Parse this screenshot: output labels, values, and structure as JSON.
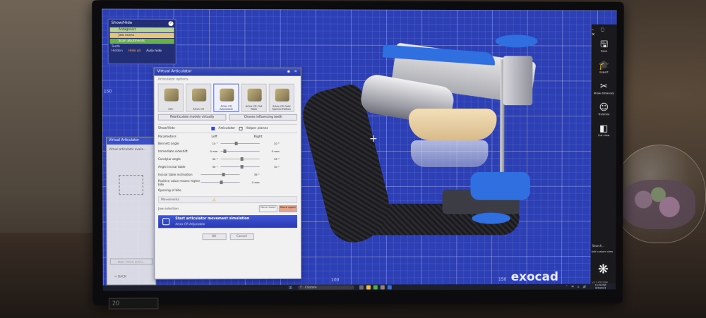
{
  "app": {
    "brand": "exocad"
  },
  "viewport": {
    "rulers": [
      "150",
      "100",
      "150",
      "50",
      "100",
      "150"
    ]
  },
  "showhide_panel": {
    "title": "Show/Hide",
    "items": [
      "Antagonist",
      "Jaw scans",
      "Scan abutments"
    ],
    "item_colors": [
      "#b8d39a",
      "#e5c47e",
      "#6ab04a"
    ],
    "teeth_label": "Teeth",
    "hidden_label": "Hidden",
    "hide_all": "Hide all",
    "auto_hide": "Auto hide"
  },
  "va_panel": {
    "title": "Virtual Articulator",
    "options_label": "Articulator options",
    "articulators": [
      {
        "name": "A2C"
      },
      {
        "name": "Artex CR"
      },
      {
        "name": "Artex CR Adjustable"
      },
      {
        "name": "Artex CR Flat Table"
      },
      {
        "name": "Artex CR Gold Special Edition"
      }
    ],
    "realculate_btn": "Rearticulate models virtually",
    "influence_btn": "Choose influencing teeth",
    "showhide_label": "Show/Hide",
    "articulator_cb": "Articulator",
    "helper_cb": "Helper planes",
    "parameters_label": "Parameters",
    "left_label": "Left",
    "right_label": "Right",
    "params": [
      {
        "name": "Bennett angle",
        "left": "10 °",
        "right": "10 °"
      },
      {
        "name": "Immediate sideshift",
        "left": "0 mm",
        "right": "0 mm"
      },
      {
        "name": "Condylar angle",
        "left": "30 °",
        "right": "35 °"
      },
      {
        "name": "Angle incisal table",
        "left": "30 °",
        "right": "30 °"
      }
    ],
    "incisal_inclination": {
      "name": "Incisal table inclination",
      "value": "35 °"
    },
    "positive_values": {
      "name": "Positive value means higher bite",
      "value": "0 mm"
    },
    "opening_bite": {
      "name": "Opening of bite"
    },
    "movements_label": "Movements",
    "jaw_selection_label": "Jaw selection",
    "move_lower": "Move lower",
    "move_upper": "Move upper",
    "start_title": "Start articulator movement simulation",
    "start_sub": "Artex CR Adjustable",
    "ok": "OK",
    "cancel": "Cancel"
  },
  "va_small": {
    "title": "Virtual Articulator",
    "text": "Virtual articulator availa...",
    "start": "Start virtual articu...",
    "back": "< BACK"
  },
  "toolbar": {
    "save": "Save",
    "expert": "Expert",
    "show_distances": "Show distances",
    "trusmile": "TruSmile",
    "cut_view": "Cut view",
    "search": "Search...",
    "add_custom_view": "Add custom view",
    "version": "v3.2-8552/64"
  },
  "taskbar": {
    "search_placeholder": "Căutare",
    "time": "10:58 PM",
    "date": "6/5/2024"
  },
  "monitor_label": "20"
}
